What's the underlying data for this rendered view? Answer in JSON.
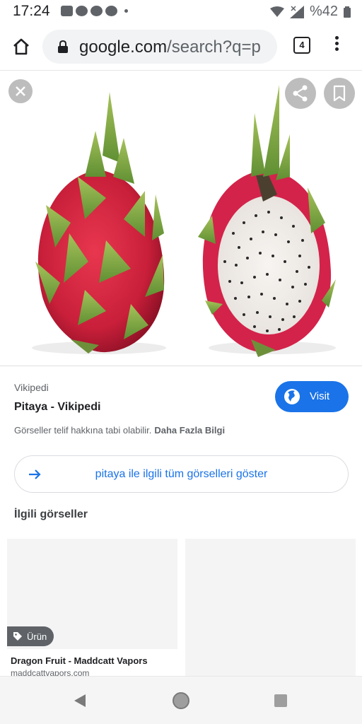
{
  "status_bar": {
    "time": "17:24",
    "battery": "%42",
    "icons": [
      "youtube-icon",
      "whatsapp-icon",
      "messenger-icon",
      "messenger-icon",
      "dot-icon",
      "wifi-icon",
      "signal-icon",
      "battery-icon"
    ]
  },
  "browser": {
    "url_host": "google.com",
    "url_rest": "/search?q=p",
    "tab_count": "4"
  },
  "image_viewer": {
    "accent": "#1a73e8"
  },
  "result": {
    "source": "Vikipedi",
    "title": "Pitaya - Vikipedi",
    "visit_label": "Visit",
    "copyright_text": "Görseller telif hakkına tabi olabilir.",
    "learn_more": "Daha Fazla Bilgi"
  },
  "show_all": {
    "label": "pitaya ile ilgili tüm görselleri göster"
  },
  "related": {
    "heading": "İlgili görseller",
    "cards": [
      {
        "badge": "Ürün",
        "title": "Dragon Fruit - Maddcatt Vapors",
        "domain": "maddcattvapors.com"
      },
      {
        "title": "",
        "domain": ""
      }
    ]
  }
}
